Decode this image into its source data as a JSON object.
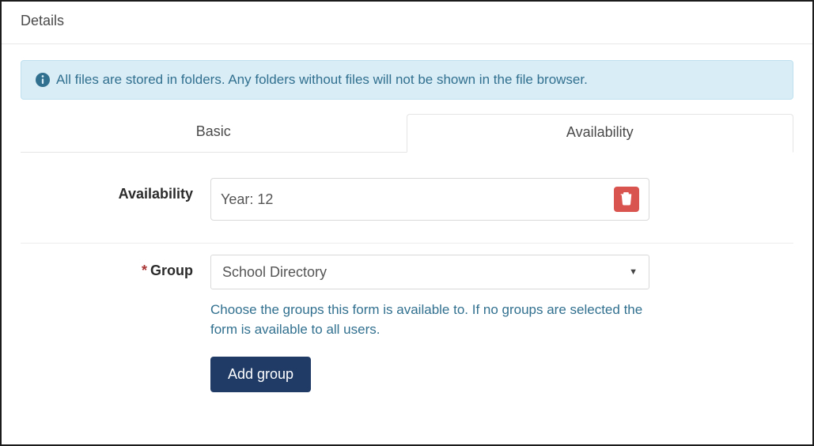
{
  "header": {
    "title": "Details"
  },
  "info": {
    "message": "All files are stored in folders. Any folders without files will not be shown in the file browser."
  },
  "tabs": {
    "basic": {
      "label": "Basic",
      "active": false
    },
    "availability": {
      "label": "Availability",
      "active": true
    }
  },
  "form": {
    "availability": {
      "label": "Availability",
      "value": "Year: 12"
    },
    "group": {
      "label": "Group",
      "required": true,
      "selected": "School Directory",
      "help": "Choose the groups this form is available to. If no groups are selected the form is available to all users."
    },
    "add_group_label": "Add group"
  },
  "icons": {
    "info": "info-icon",
    "trash": "trash-icon",
    "caret": "caret-down-icon"
  },
  "colors": {
    "info_bg": "#d9edf7",
    "info_fg": "#31708f",
    "danger": "#d9534f",
    "primary": "#1f3b66"
  }
}
